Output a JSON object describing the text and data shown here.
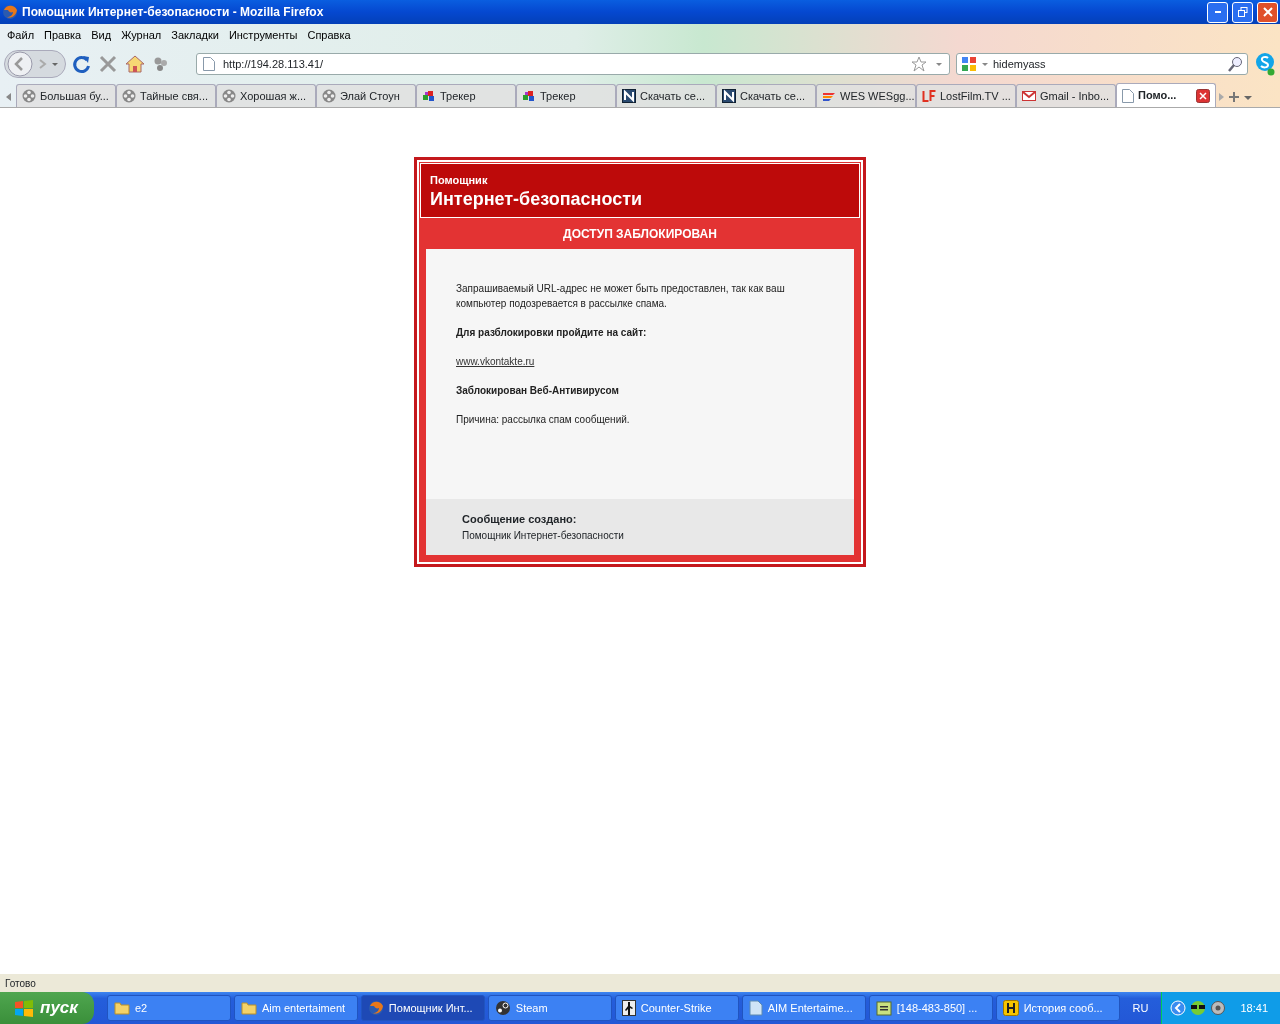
{
  "window": {
    "title": "Помощник Интернет-безопасности - Mozilla Firefox"
  },
  "menu": [
    "Файл",
    "Правка",
    "Вид",
    "Журнал",
    "Закладки",
    "Инструменты",
    "Справка"
  ],
  "address": {
    "value": "http://194.28.113.41/"
  },
  "search": {
    "value": "hidemyass"
  },
  "tabs": [
    {
      "kind": "reel",
      "label": "Большая бу...",
      "selected": false
    },
    {
      "kind": "reel",
      "label": "Тайные свя...",
      "selected": false
    },
    {
      "kind": "reel",
      "label": "Хорошая ж...",
      "selected": false
    },
    {
      "kind": "reel",
      "label": "Элай Стоун",
      "selected": false
    },
    {
      "kind": "tracker",
      "label": "Трекер",
      "selected": false
    },
    {
      "kind": "tracker",
      "label": "Трекер",
      "selected": false
    },
    {
      "kind": "n",
      "label": "Скачать се...",
      "selected": false
    },
    {
      "kind": "n",
      "label": "Скачать се...",
      "selected": false
    },
    {
      "kind": "stripes",
      "label": "WES WESgg...",
      "selected": false
    },
    {
      "kind": "lf",
      "label": "LostFilm.TV ...",
      "selected": false
    },
    {
      "kind": "mail",
      "label": "Gmail - Inbo...",
      "selected": false
    },
    {
      "kind": "page",
      "label": "Помо...",
      "selected": true
    }
  ],
  "block_page": {
    "brand_small": "Помощник",
    "brand_large": "Интернет-безопасности",
    "banner": "ДОСТУП ЗАБЛОКИРОВАН",
    "message": "Запрашиваемый URL-адрес не может быть предоставлен, так как ваш компьютер подозревается в рассылке спама.",
    "unblock_heading": "Для разблокировки пройдите на сайт:",
    "link": "www.vkontakte.ru",
    "blocked_by": "Заблокирован Веб-Антивирусом",
    "reason": "Причина: рассылка спам сообщений.",
    "footer_heading": "Сообщение создано:",
    "footer_text": "Помощник Интернет-безопасности"
  },
  "status_bar": "Готово",
  "taskbar": {
    "start": "пуск",
    "buttons": [
      {
        "kind": "folder",
        "label": "e2",
        "selected": false
      },
      {
        "kind": "folder",
        "label": "Aim entertaiment",
        "selected": false
      },
      {
        "kind": "firefox",
        "label": "Помощник Инт...",
        "selected": true
      },
      {
        "kind": "steam",
        "label": "Steam",
        "selected": false
      },
      {
        "kind": "cs",
        "label": "Counter-Strike",
        "selected": false
      },
      {
        "kind": "doc",
        "label": "AIM Entertaime...",
        "selected": false
      },
      {
        "kind": "icq",
        "label": "[148-483-850] ...",
        "selected": false
      },
      {
        "kind": "h",
        "label": "История сооб...",
        "selected": false
      }
    ],
    "language": "RU",
    "clock": "18:41"
  }
}
